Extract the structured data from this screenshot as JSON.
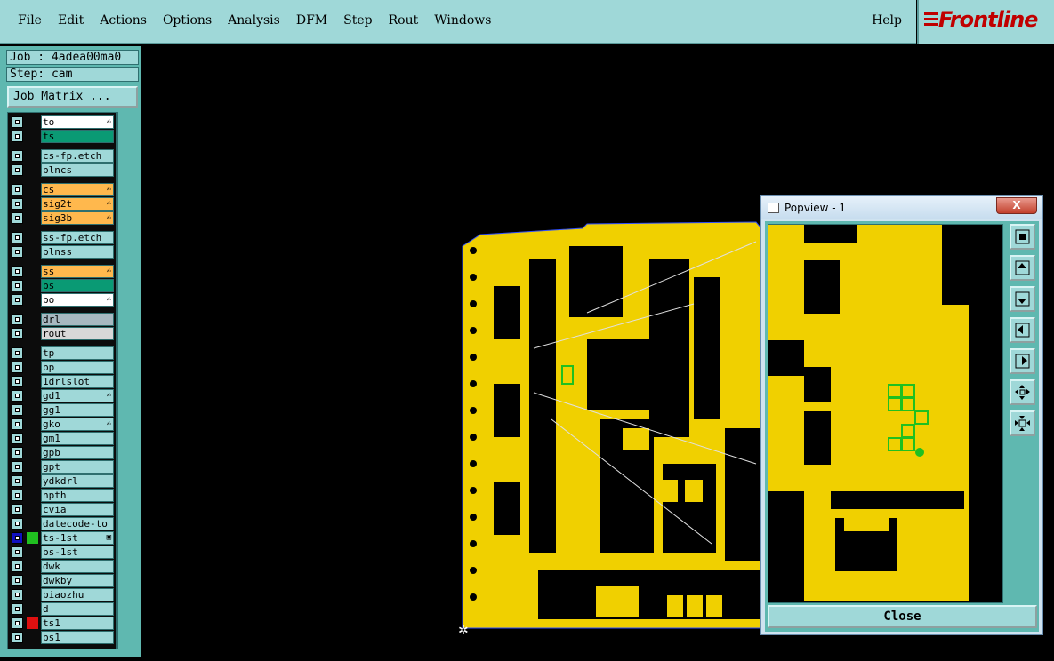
{
  "menu": {
    "items": [
      "File",
      "Edit",
      "Actions",
      "Options",
      "Analysis",
      "DFM",
      "Step",
      "Rout",
      "Windows"
    ],
    "help": "Help"
  },
  "logo": {
    "text": "Frontline"
  },
  "job": {
    "job_line": "Job : 4adea00ma0",
    "step_line": "Step: cam",
    "matrix_button": "Job Matrix ..."
  },
  "layers": [
    {
      "name": "to",
      "color": "#ffffff",
      "flag": true,
      "group": 0
    },
    {
      "name": "ts",
      "color": "#0a9a74",
      "flag": false,
      "group": 0
    },
    {
      "name": "cs-fp.etch",
      "color": "#9fd8d8",
      "flag": false,
      "group": 1
    },
    {
      "name": "plncs",
      "color": "#9fd8d8",
      "flag": false,
      "group": 1
    },
    {
      "name": "cs",
      "color": "#ffb84d",
      "flag": true,
      "group": 2
    },
    {
      "name": "sig2t",
      "color": "#ffb84d",
      "flag": true,
      "group": 2
    },
    {
      "name": "sig3b",
      "color": "#ffb84d",
      "flag": true,
      "group": 2
    },
    {
      "name": "ss-fp.etch",
      "color": "#9fd8d8",
      "flag": false,
      "group": 3
    },
    {
      "name": "plnss",
      "color": "#9fd8d8",
      "flag": false,
      "group": 3
    },
    {
      "name": "ss",
      "color": "#ffb84d",
      "flag": true,
      "group": 4
    },
    {
      "name": "bs",
      "color": "#0a9a74",
      "flag": false,
      "group": 4
    },
    {
      "name": "bo",
      "color": "#ffffff",
      "flag": true,
      "group": 4
    },
    {
      "name": "drl",
      "color": "#a8b8c0",
      "flag": false,
      "group": 5
    },
    {
      "name": "rout",
      "color": "#d8d8d8",
      "flag": false,
      "group": 5
    },
    {
      "name": "tp",
      "color": "#9fd8d8",
      "flag": false,
      "group": 6
    },
    {
      "name": "bp",
      "color": "#9fd8d8",
      "flag": false,
      "group": 6
    },
    {
      "name": "1drlslot",
      "color": "#9fd8d8",
      "flag": false,
      "group": 6
    },
    {
      "name": "gd1",
      "color": "#9fd8d8",
      "flag": true,
      "group": 6
    },
    {
      "name": "gg1",
      "color": "#9fd8d8",
      "flag": false,
      "group": 6
    },
    {
      "name": "gko",
      "color": "#9fd8d8",
      "flag": true,
      "group": 6
    },
    {
      "name": "gm1",
      "color": "#9fd8d8",
      "flag": false,
      "group": 6
    },
    {
      "name": "gpb",
      "color": "#9fd8d8",
      "flag": false,
      "group": 6
    },
    {
      "name": "gpt",
      "color": "#9fd8d8",
      "flag": false,
      "group": 6
    },
    {
      "name": "ydkdrl",
      "color": "#9fd8d8",
      "flag": false,
      "group": 6
    },
    {
      "name": "npth",
      "color": "#9fd8d8",
      "flag": false,
      "group": 6
    },
    {
      "name": "cvia",
      "color": "#9fd8d8",
      "flag": false,
      "group": 6
    },
    {
      "name": "datecode-to",
      "color": "#9fd8d8",
      "flag": false,
      "group": 6
    },
    {
      "name": "ts-1st",
      "color": "#9fd8d8",
      "flag": false,
      "group": 6,
      "swatch": "#20c020",
      "active": true
    },
    {
      "name": "bs-1st",
      "color": "#9fd8d8",
      "flag": false,
      "group": 6
    },
    {
      "name": "dwk",
      "color": "#9fd8d8",
      "flag": false,
      "group": 6
    },
    {
      "name": "dwkby",
      "color": "#9fd8d8",
      "flag": false,
      "group": 6
    },
    {
      "name": "biaozhu",
      "color": "#9fd8d8",
      "flag": false,
      "group": 6
    },
    {
      "name": "d",
      "color": "#9fd8d8",
      "flag": false,
      "group": 6
    },
    {
      "name": "ts1",
      "color": "#9fd8d8",
      "flag": false,
      "group": 6,
      "swatch": "#e01010"
    },
    {
      "name": "bs1",
      "color": "#9fd8d8",
      "flag": false,
      "group": 6
    }
  ],
  "popview": {
    "title": "Popview - 1",
    "close_label": "Close",
    "close_x": "X"
  },
  "colors": {
    "panel": "#5fb8b0",
    "menubar": "#9fd8d8",
    "board": "#f0d000",
    "highlight": "#20c020"
  }
}
